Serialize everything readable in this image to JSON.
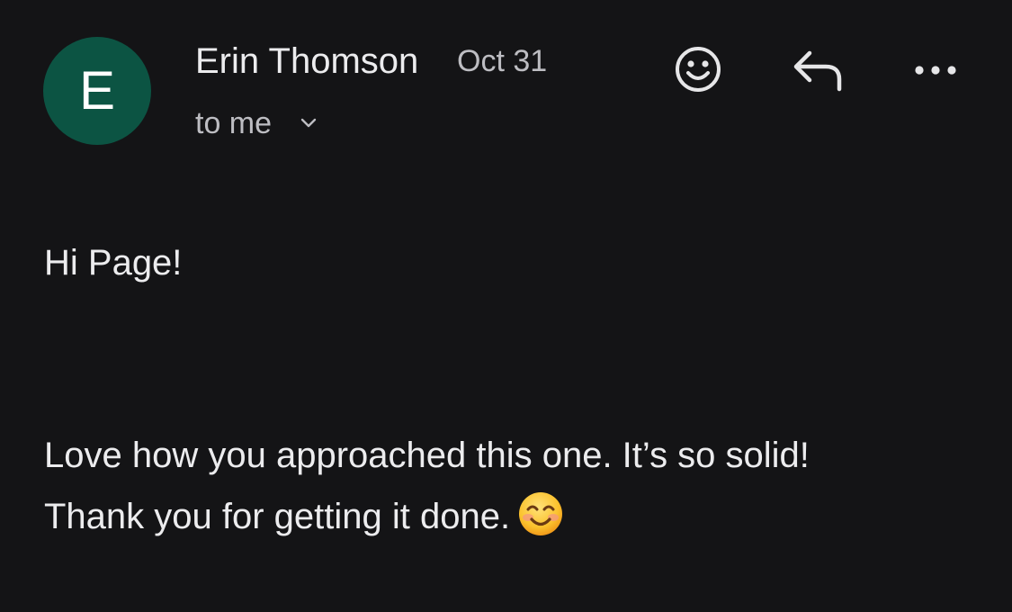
{
  "email": {
    "avatar_initial": "E",
    "avatar_color": "#0c5443",
    "sender_name": "Erin Thomson",
    "date": "Oct 31",
    "recipient_label": "to me",
    "body": {
      "greeting": "Hi Page!",
      "line1": "Love how you approached this one. It’s so solid!",
      "line2": "Thank you for getting it done."
    }
  },
  "actions": {
    "react_icon": "smiley-face-icon",
    "reply_icon": "reply-arrow-icon",
    "more_icon": "more-horizontal-icon",
    "expand_icon": "chevron-down-icon"
  },
  "inline_emoji": "smiling-face-with-smiling-eyes"
}
